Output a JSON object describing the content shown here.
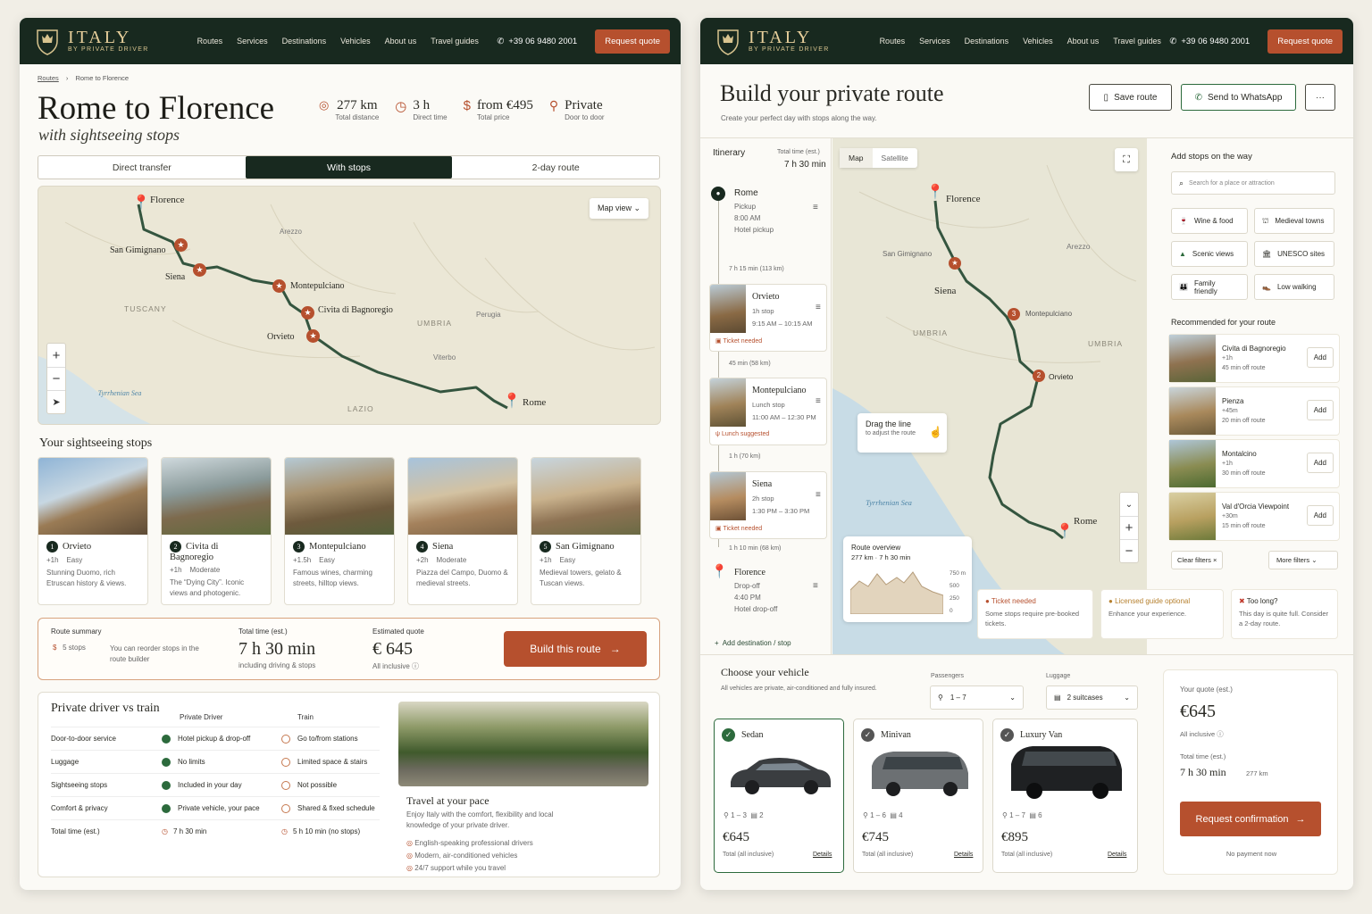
{
  "brand": {
    "title": "ITALY",
    "subtitle": "BY PRIVATE DRIVER"
  },
  "nav": [
    "Routes",
    "Services",
    "Destinations",
    "Vehicles",
    "About us",
    "Travel guides"
  ],
  "phone": "+39 06 9480 2001",
  "request_quote": "Request quote",
  "colors": {
    "dark_green": "#18291f",
    "accent": "#b6502e",
    "route": "#34553f"
  },
  "left": {
    "breadcrumb": {
      "root": "Routes",
      "current": "Rome to Florence"
    },
    "title": "Rome to Florence",
    "subtitle": "with sightseeing stops",
    "stats": [
      {
        "icon": "distance-icon",
        "value": "277 km",
        "label": "Total distance"
      },
      {
        "icon": "clock-icon",
        "value": "3 h",
        "label": "Direct time"
      },
      {
        "icon": "dollar-icon",
        "value": "from €495",
        "label": "Total price"
      },
      {
        "icon": "person-icon",
        "value": "Private",
        "label": "Door to door"
      }
    ],
    "tabs": [
      "Direct transfer",
      "With stops",
      "2-day route"
    ],
    "map": {
      "view": "Map view",
      "labels": {
        "florence": "Florence",
        "sangimignano": "San Gimignano",
        "siena": "Siena",
        "montepulciano": "Montepulciano",
        "civita": "Civita di Bagnoregio",
        "orvieto": "Orvieto",
        "rome": "Rome",
        "arezzo": "Arezzo",
        "perugia": "Perugia",
        "viterbo": "Viterbo",
        "tuscany": "TUSCANY",
        "umbria": "UMBRIA",
        "lazio": "LAZIO",
        "sea": "Tyrrhenian Sea"
      }
    },
    "stops_heading": "Your sightseeing stops",
    "stops": [
      {
        "n": "1",
        "name": "Orvieto",
        "time": "+1h",
        "level": "Easy",
        "desc": "Stunning Duomo, rich Etruscan history & views."
      },
      {
        "n": "2",
        "name": "Civita di Bagnoregio",
        "time": "+1h",
        "level": "Moderate",
        "desc": "The “Dying City”. Iconic views and photogenic."
      },
      {
        "n": "3",
        "name": "Montepulciano",
        "time": "+1.5h",
        "level": "Easy",
        "desc": "Famous wines, charming streets, hilltop views."
      },
      {
        "n": "4",
        "name": "Siena",
        "time": "+2h",
        "level": "Moderate",
        "desc": "Piazza del Campo, Duomo & medieval streets."
      },
      {
        "n": "5",
        "name": "San Gimignano",
        "time": "+1h",
        "level": "Easy",
        "desc": "Medieval towers, gelato & Tuscan views."
      }
    ],
    "summary": {
      "label": "Route summary",
      "stops": "5 stops",
      "reorder": "You can reorder stops in the route builder",
      "time_label": "Total time (est.)",
      "time": "7 h 30 min",
      "time_note": "including driving & stops",
      "quote_label": "Estimated quote",
      "quote": "€ 645",
      "quote_note": "All inclusive",
      "cta": "Build this route"
    },
    "compare": {
      "title": "Private driver vs train",
      "col1": "Private Driver",
      "col2": "Train",
      "rows": [
        {
          "k": "Door-to-door service",
          "a": "Hotel pickup & drop-off",
          "b": "Go to/from stations"
        },
        {
          "k": "Luggage",
          "a": "No limits",
          "b": "Limited space & stairs"
        },
        {
          "k": "Sightseeing stops",
          "a": "Included in your day",
          "b": "Not possible"
        },
        {
          "k": "Comfort & privacy",
          "a": "Private vehicle, your pace",
          "b": "Shared & fixed schedule"
        },
        {
          "k": "Total time (est.)",
          "a": "7 h 30 min",
          "b": "5 h 10 min (no stops)"
        }
      ]
    },
    "promo": {
      "title": "Travel at your pace",
      "text": "Enjoy Italy with the comfort, flexibility and local knowledge of your private driver.",
      "bullets": [
        "English-speaking professional drivers",
        "Modern, air-conditioned vehicles",
        "24/7 support while you travel"
      ]
    }
  },
  "right": {
    "title": "Build your private route",
    "subtitle": "Create your perfect day with stops along the way.",
    "save": "Save route",
    "whatsapp": "Send to WhatsApp",
    "more": "···",
    "itinerary": {
      "label": "Itinerary",
      "total_label": "Total time (est.)",
      "total": "7 h 30 min",
      "start": {
        "name": "Rome",
        "l1": "Pickup",
        "l2": "8:00 AM",
        "l3": "Hotel pickup"
      },
      "legs": [
        "7 h 15 min (113 km)",
        "45 min (58 km)",
        "1 h (70 km)",
        "1 h 10 min (68 km)"
      ],
      "stops": [
        {
          "name": "Orvieto",
          "dur": "1h stop",
          "time": "9:15 AM – 10:15 AM",
          "tag": "Ticket needed"
        },
        {
          "name": "Montepulciano",
          "dur": "Lunch stop",
          "time": "11:00 AM – 12:30 PM",
          "tag": "Lunch suggested"
        },
        {
          "name": "Siena",
          "dur": "2h stop",
          "time": "1:30 PM – 3:30 PM",
          "tag": "Ticket needed"
        }
      ],
      "end": {
        "name": "Florence",
        "l1": "Drop-off",
        "l2": "4:40 PM",
        "l3": "Hotel drop-off"
      },
      "add": "Add destination / stop"
    },
    "map": {
      "tab1": "Map",
      "tab2": "Satellite",
      "labels": {
        "florence": "Florence",
        "sangimignano": "San Gimignano",
        "siena": "Siena",
        "montepulciano": "Montepulciano",
        "orvieto": "Orvieto",
        "rome": "Rome",
        "arezzo": "Arezzo",
        "umbria1": "UMBRIA",
        "umbria2": "UMBRIA",
        "sea": "Tyrrhenian Sea"
      },
      "drag_title": "Drag the line",
      "drag_sub": "to adjust the route",
      "overview": {
        "title": "Route overview",
        "sub": "277 km · 7 h 30 min",
        "ticks": [
          "750 m",
          "500",
          "250",
          "0"
        ]
      }
    },
    "notes": [
      {
        "title": "Ticket needed",
        "text": "Some stops require pre-booked tickets."
      },
      {
        "title": "Licensed guide optional",
        "text": "Enhance your experience."
      },
      {
        "title": "Too long?",
        "text": "This day is quite full. Consider a 2-day route."
      }
    ],
    "addstops": {
      "title": "Add stops on the way",
      "placeholder": "Search for a place or attraction",
      "cats": [
        {
          "icon": "wine-icon",
          "label": "Wine & food"
        },
        {
          "icon": "town-icon",
          "label": "Medieval towns"
        },
        {
          "icon": "mountain-icon",
          "label": "Scenic views"
        },
        {
          "icon": "unesco-icon",
          "label": "UNESCO sites"
        },
        {
          "icon": "family-icon",
          "label": "Family friendly"
        },
        {
          "icon": "shoe-icon",
          "label": "Low walking"
        }
      ],
      "rec_title": "Recommended for your route",
      "recs": [
        {
          "name": "Civita di Bagnoregio",
          "time": "+1h",
          "off": "45 min off route"
        },
        {
          "name": "Pienza",
          "time": "+45m",
          "off": "20 min off route"
        },
        {
          "name": "Montalcino",
          "time": "+1h",
          "off": "30 min off route"
        },
        {
          "name": "Val d'Orcia Viewpoint",
          "time": "+30m",
          "off": "15 min off route"
        }
      ],
      "add": "Add",
      "clear": "Clear filters",
      "more": "More filters"
    },
    "vehicle": {
      "title": "Choose your vehicle",
      "sub": "All vehicles are private, air-conditioned and fully insured.",
      "pass_label": "Passengers",
      "pass": "1 – 7",
      "lug_label": "Luggage",
      "lug": "2 suitcases",
      "cars": [
        {
          "name": "Sedan",
          "pax": "1 – 3",
          "bags": "2",
          "price": "€645",
          "note": "Total (all inclusive)",
          "details": "Details"
        },
        {
          "name": "Minivan",
          "pax": "1 – 6",
          "bags": "4",
          "price": "€745",
          "note": "Total (all inclusive)",
          "details": "Details"
        },
        {
          "name": "Luxury Van",
          "pax": "1 – 7",
          "bags": "6",
          "price": "€895",
          "note": "Total (all inclusive)",
          "details": "Details"
        }
      ]
    },
    "quote": {
      "label": "Your quote (est.)",
      "value": "€645",
      "incl": "All inclusive",
      "time_label": "Total time (est.)",
      "time": "7 h 30 min",
      "km": "277 km",
      "cta": "Request confirmation",
      "note": "No payment now"
    }
  }
}
